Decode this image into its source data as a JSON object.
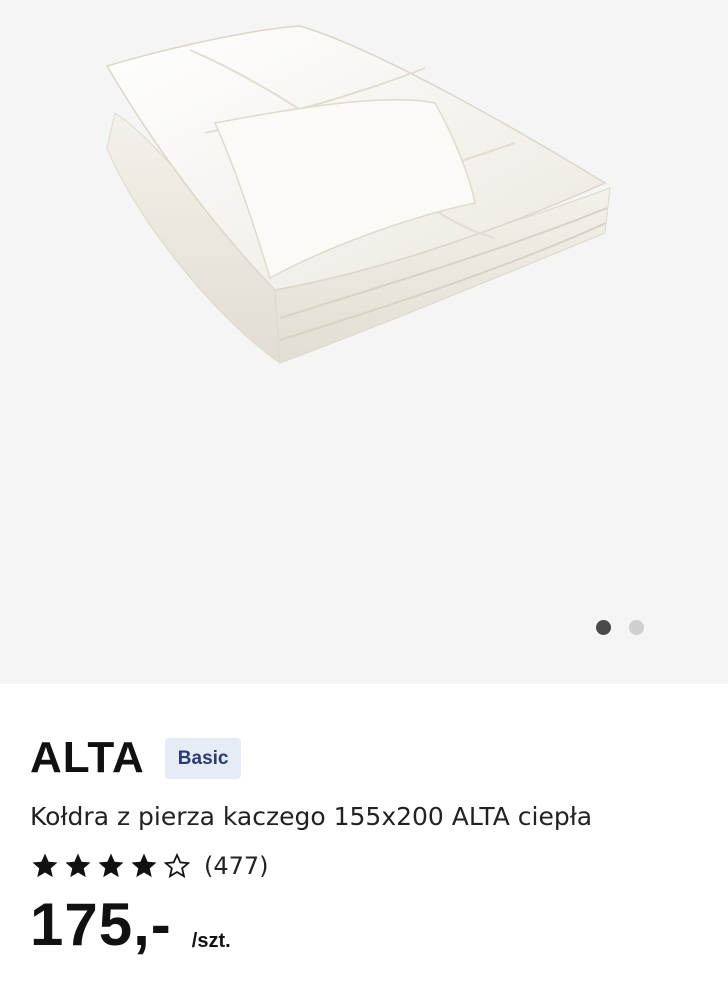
{
  "gallery": {
    "image_alt": "kołdra",
    "current_slide": 1,
    "total_slides": 2
  },
  "product": {
    "brand": "ALTA",
    "badge": "Basic",
    "name": "Kołdra z pierza kaczego 155x200 ALTA ciepła",
    "rating": 4,
    "rating_max": 5,
    "review_count": "(477)",
    "price": "175,-",
    "unit": "/szt."
  },
  "colors": {
    "gallery_bg": "#f5f5f5",
    "badge_bg": "#e6ecf5",
    "badge_text": "#2b3a70",
    "dot_active": "#4a4a4a",
    "dot_inactive": "#cfcfcf"
  }
}
